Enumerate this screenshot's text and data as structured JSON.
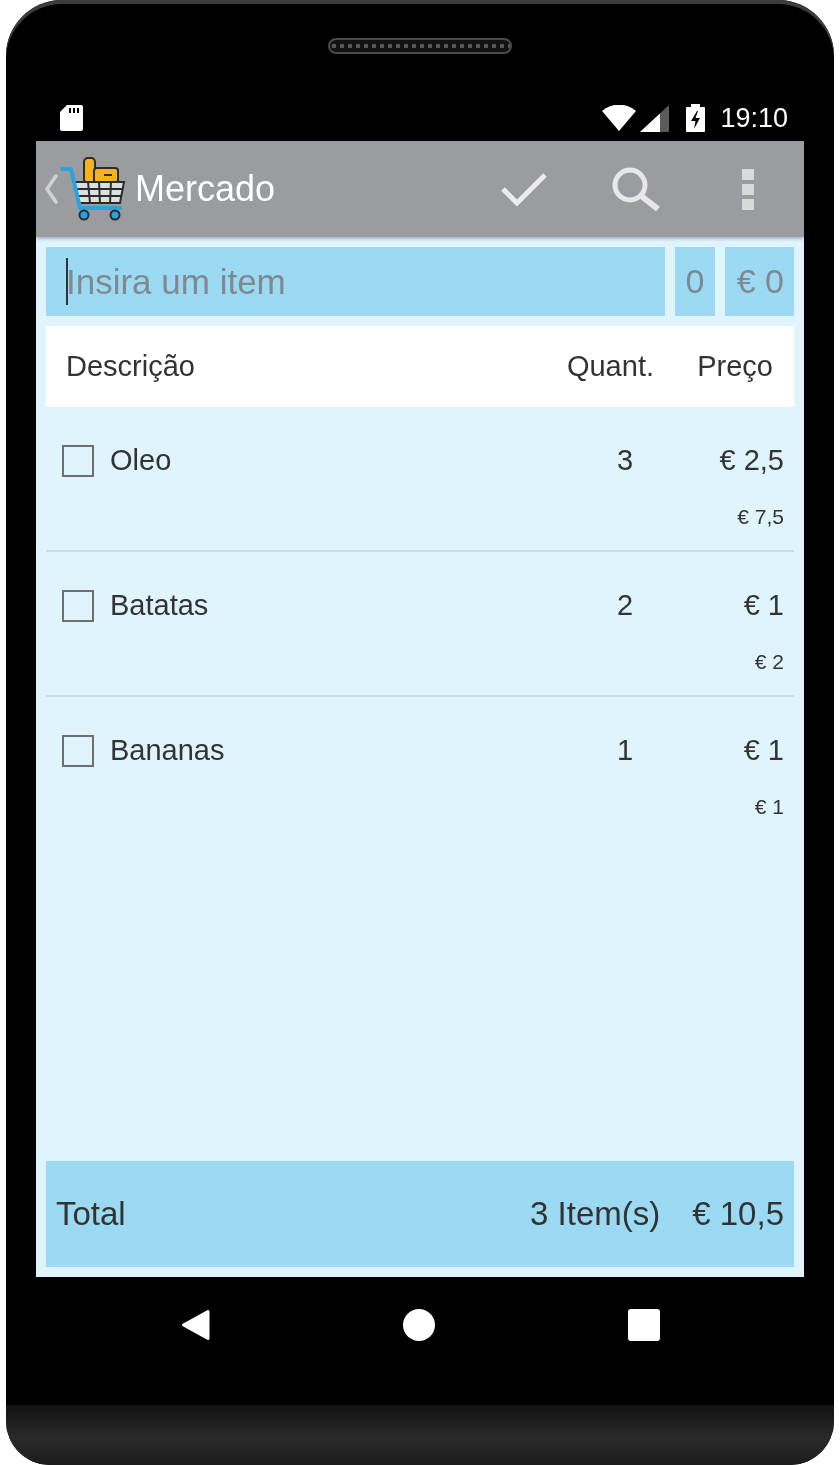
{
  "status_bar": {
    "time": "19:10"
  },
  "app_bar": {
    "title": "Mercado"
  },
  "entry": {
    "item": {
      "placeholder": "Insira um item",
      "focused": true
    },
    "quantity": {
      "placeholder": "0"
    },
    "price": {
      "placeholder": "€ 0"
    }
  },
  "table": {
    "columns": [
      "Descrição",
      "Quant.",
      "Preço"
    ],
    "rows": [
      {
        "description": "Oleo",
        "quantity": "3",
        "price": "€ 2,5",
        "subtotal": "€ 7,5",
        "checked": false
      },
      {
        "description": "Batatas",
        "quantity": "2",
        "price": "€ 1",
        "subtotal": "€ 2",
        "checked": false
      },
      {
        "description": "Bananas",
        "quantity": "1",
        "price": "€ 1",
        "subtotal": "€ 1",
        "checked": false
      }
    ]
  },
  "total": {
    "label": "Total",
    "count": "3 Item(s)",
    "amount": "€ 10,5"
  }
}
